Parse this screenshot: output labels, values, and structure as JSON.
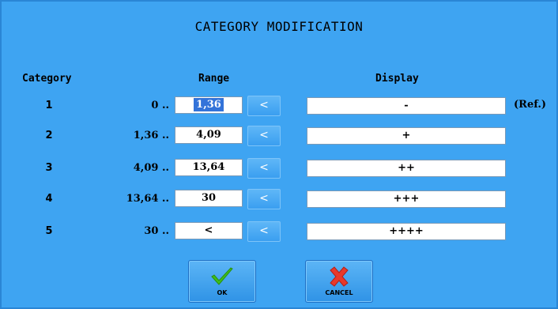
{
  "dialog": {
    "title": "CATEGORY MODIFICATION",
    "headers": {
      "category": "Category",
      "range": "Range",
      "display": "Display"
    }
  },
  "rows": [
    {
      "category": "1",
      "from": "0 ..",
      "to": "1,36",
      "to_selected": true,
      "button": "<",
      "display": "-",
      "suffix": "(Ref.)"
    },
    {
      "category": "2",
      "from": "1,36 ..",
      "to": "4,09",
      "to_selected": false,
      "button": "<",
      "display": "+",
      "suffix": ""
    },
    {
      "category": "3",
      "from": "4,09 ..",
      "to": "13,64",
      "to_selected": false,
      "button": "<",
      "display": "++",
      "suffix": ""
    },
    {
      "category": "4",
      "from": "13,64 ..",
      "to": "30",
      "to_selected": false,
      "button": "<",
      "display": "+++",
      "suffix": ""
    },
    {
      "category": "5",
      "from": "30 ..",
      "to": "<",
      "to_selected": false,
      "button": "<",
      "display": "++++",
      "suffix": ""
    }
  ],
  "buttons": {
    "ok": {
      "label": "OK",
      "icon": "checkmark-icon"
    },
    "cancel": {
      "label": "CANCEL",
      "icon": "red-x-icon"
    }
  },
  "colors": {
    "background": "#3ea4f2",
    "selection": "#3373d9",
    "ok_icon": "#3fbf1a",
    "cancel_icon": "#e8392b"
  }
}
